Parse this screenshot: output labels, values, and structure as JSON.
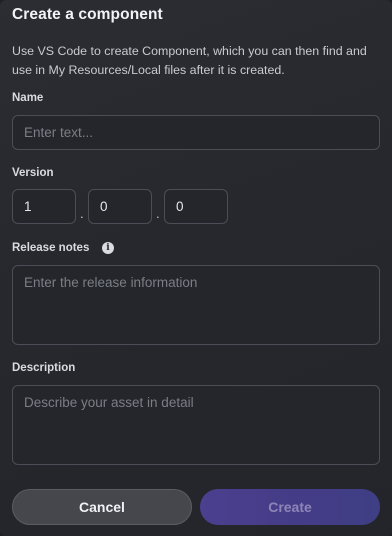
{
  "dialog": {
    "title": "Create a component",
    "description": "Use VS Code to create Component, which you can then find and use in My Resources/Local files after it is created."
  },
  "name_field": {
    "label": "Name",
    "value": "",
    "placeholder": "Enter text..."
  },
  "version": {
    "label": "Version",
    "major": "1",
    "minor": "0",
    "patch": "0",
    "separator": "."
  },
  "release_notes": {
    "label": "Release notes",
    "placeholder": "Enter the release information",
    "info_icon": "info-icon",
    "info_glyph": "i"
  },
  "description_field": {
    "label": "Description",
    "placeholder": "Describe your asset in detail"
  },
  "buttons": {
    "cancel": "Cancel",
    "create": "Create"
  },
  "colors": {
    "primary_button": "#4b3f8f",
    "primary_button_text": "#8d86b8",
    "secondary_button": "#45474d"
  }
}
